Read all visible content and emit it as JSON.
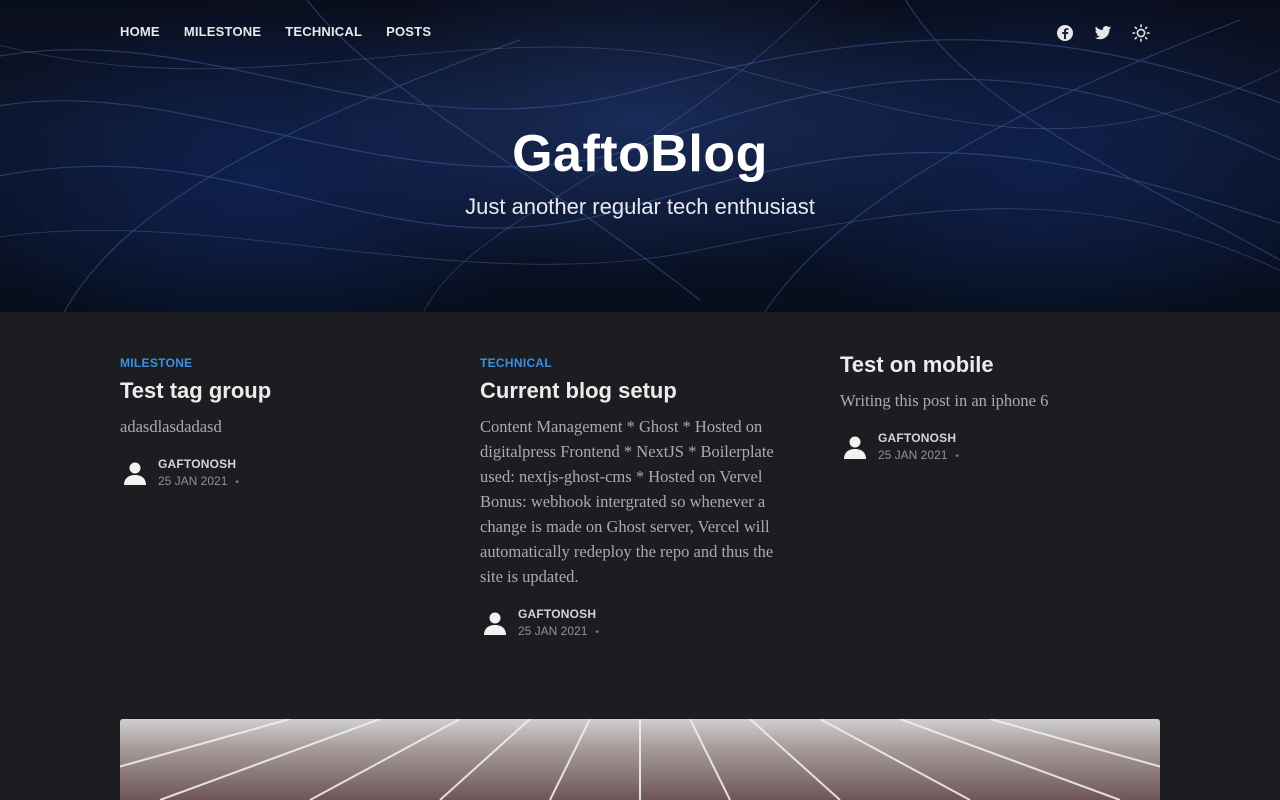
{
  "nav": {
    "items": [
      "HOME",
      "MILESTONE",
      "TECHNICAL",
      "POSTS"
    ]
  },
  "social": {
    "icons": [
      "facebook-icon",
      "twitter-icon",
      "theme-toggle-icon"
    ]
  },
  "site": {
    "title": "GaftoBlog",
    "tagline": "Just another regular tech enthusiast"
  },
  "posts": [
    {
      "tag": "MILESTONE",
      "title": "Test tag group",
      "excerpt": "adasdlasdadasd",
      "author": "GAFTONOSH",
      "date": "25 JAN 2021"
    },
    {
      "tag": "TECHNICAL",
      "title": "Current blog setup",
      "excerpt": "Content Management * Ghost * Hosted on digitalpress Frontend * NextJS * Boilerplate used: nextjs-ghost-cms * Hosted on Vervel Bonus: webhook intergrated so whenever a change is made on Ghost server, Vercel will automatically redeploy the repo and thus the site is updated.",
      "author": "GAFTONOSH",
      "date": "25 JAN 2021"
    },
    {
      "tag": "",
      "title": "Test on mobile",
      "excerpt": "Writing this post in an iphone 6",
      "author": "GAFTONOSH",
      "date": "25 JAN 2021"
    }
  ],
  "colors": {
    "accent": "#3b8fe0",
    "background": "#1c1d21"
  }
}
